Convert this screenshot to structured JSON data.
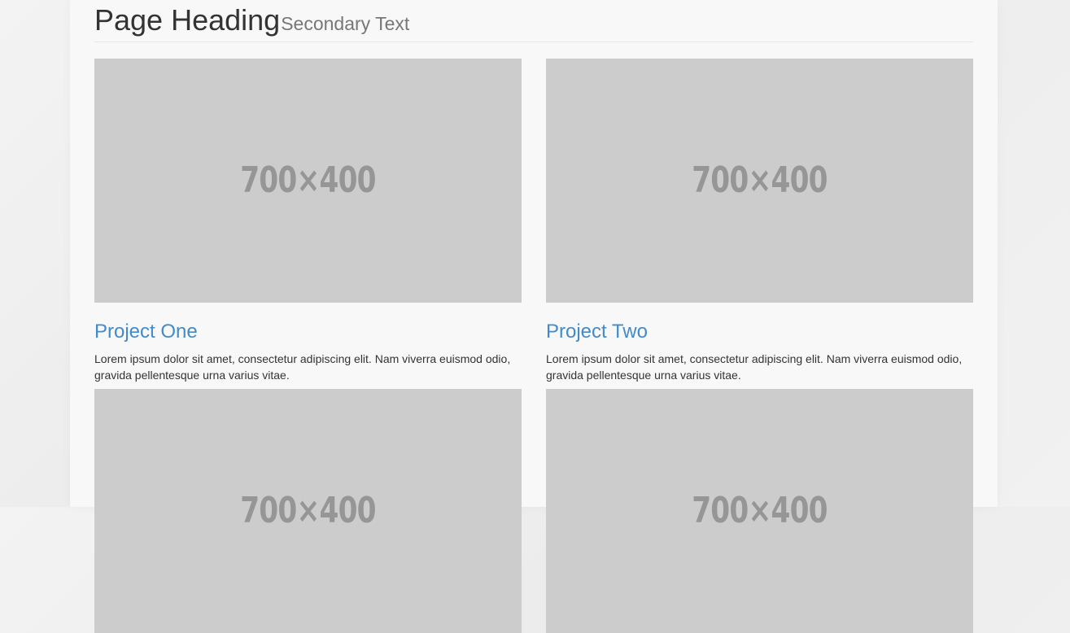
{
  "header": {
    "title": "Page Heading",
    "subtitle": "Secondary Text"
  },
  "projects": [
    {
      "image_label": "700×400",
      "title": "Project One",
      "description": "Lorem ipsum dolor sit amet, consectetur adipiscing elit. Nam viverra euismod odio, gravida pellentesque urna varius vitae."
    },
    {
      "image_label": "700×400",
      "title": "Project Two",
      "description": "Lorem ipsum dolor sit amet, consectetur adipiscing elit. Nam viverra euismod odio, gravida pellentesque urna varius vitae."
    },
    {
      "image_label": "700×400"
    },
    {
      "image_label": "700×400"
    }
  ],
  "colors": {
    "link": "#428bca",
    "placeholder_bg": "#cccccc",
    "placeholder_text": "#969696"
  }
}
